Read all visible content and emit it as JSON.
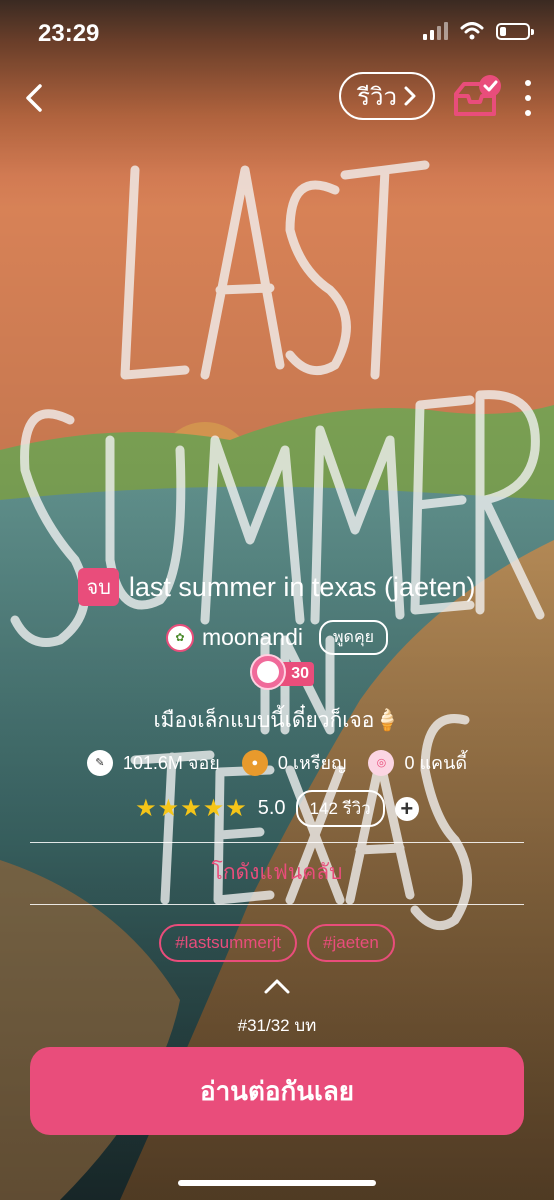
{
  "status_bar": {
    "time": "23:29"
  },
  "header": {
    "review_label": "รีวิว"
  },
  "story": {
    "status_badge": "จบ",
    "title": "last summer in texas (jaeten)",
    "author": "moonandi",
    "chat_label": "พูดคุย",
    "level": "30",
    "tagline": "เมืองเล็กแบบนี้เดี๋ยวก็เจอ🍦"
  },
  "stats": [
    {
      "icon": "pen-icon",
      "value": "101.6M จอย"
    },
    {
      "icon": "coin-icon",
      "value": "0 เหรียญ"
    },
    {
      "icon": "candy-icon",
      "value": "0 แคนดี้"
    }
  ],
  "rating": {
    "stars": "★★★★★",
    "score": "5.0",
    "review_count": "142 รีวิว",
    "stars_value": 5
  },
  "fanclub_label": "โกดังแฟนคลับ",
  "tags": [
    "#lastsummerjt",
    "#jaeten"
  ],
  "episode": "#31/32 บท",
  "read_button": "อ่านต่อกันเลย",
  "colors": {
    "accent": "#e94d7b",
    "star": "#f5c518"
  },
  "cover_text": [
    "LAST",
    "SUMMER",
    "IN",
    "TEXAS"
  ]
}
